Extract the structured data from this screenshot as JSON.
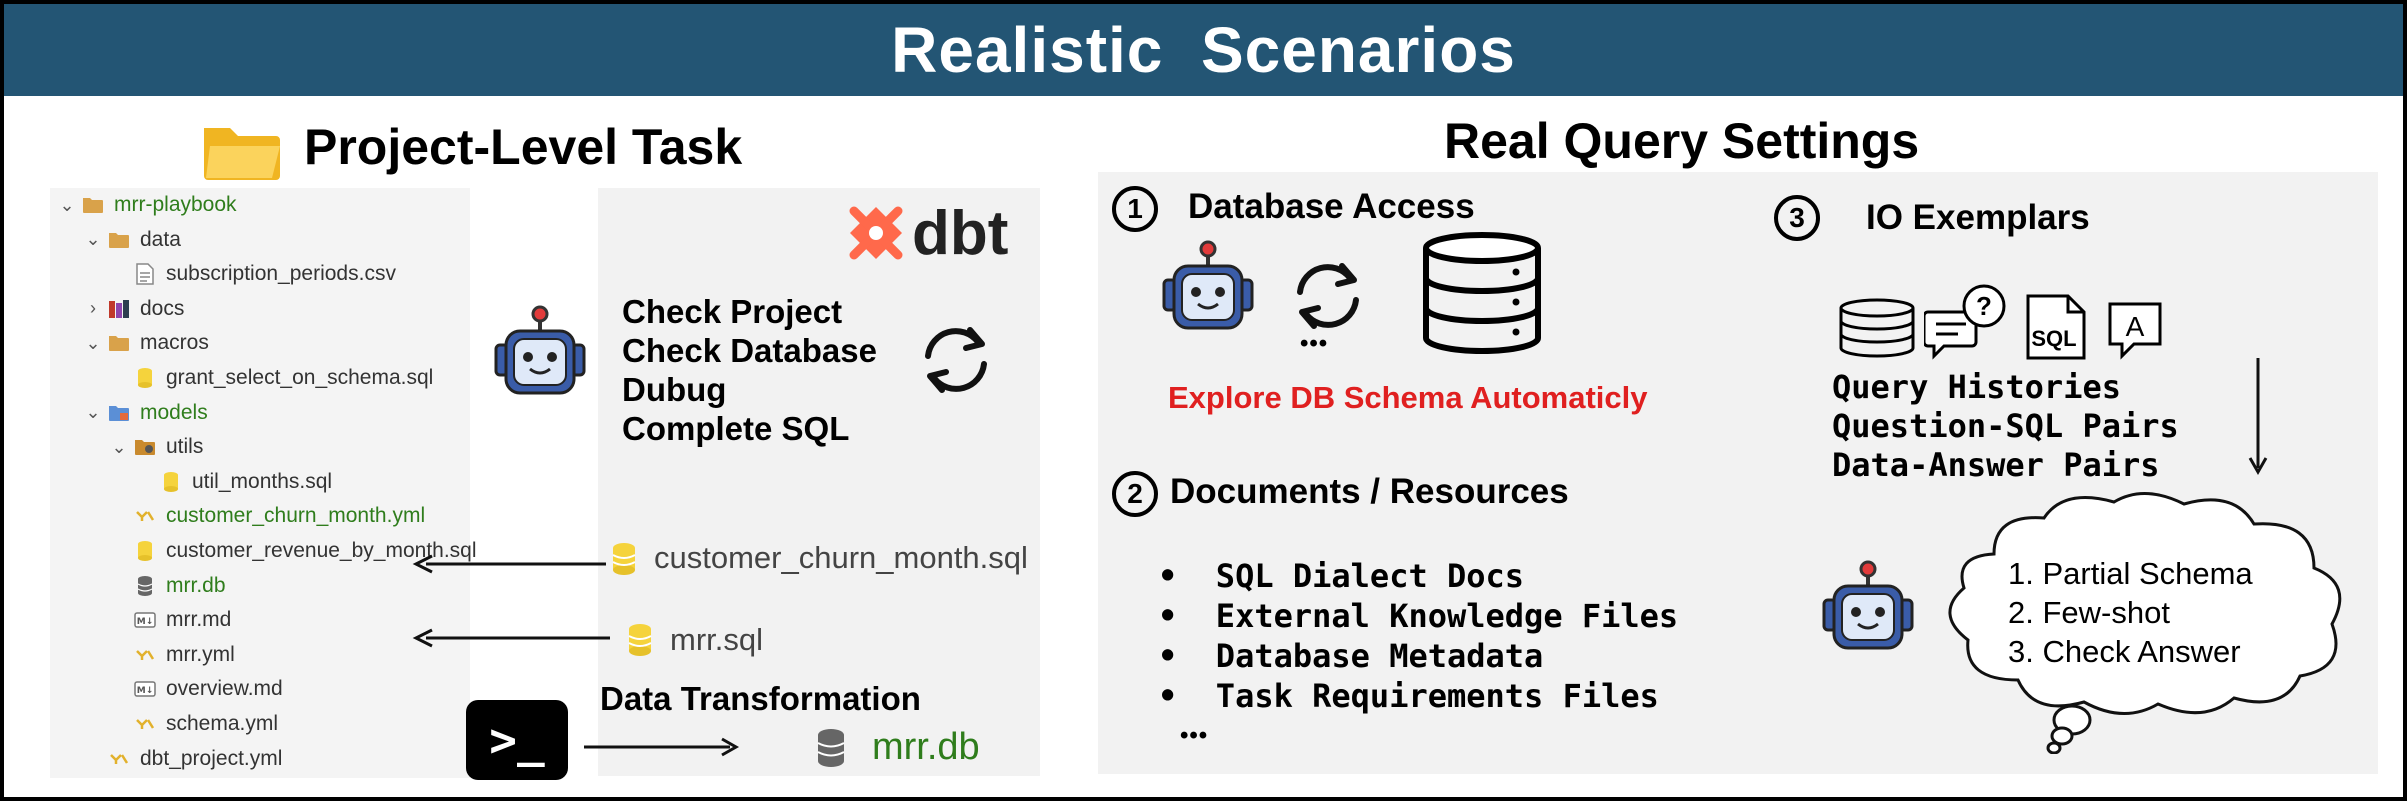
{
  "banner": {
    "title": "Realistic  Scenarios"
  },
  "left": {
    "title": "Project-Level Task",
    "tree": [
      {
        "label": "mrr-playbook",
        "depth": 0,
        "chevron": "down",
        "icon": "folder-icon",
        "green": true
      },
      {
        "label": "data",
        "depth": 1,
        "chevron": "down",
        "icon": "folder-icon",
        "green": false
      },
      {
        "label": "subscription_periods.csv",
        "depth": 2,
        "chevron": "",
        "icon": "file-icon",
        "green": false
      },
      {
        "label": "docs",
        "depth": 1,
        "chevron": "right",
        "icon": "books-icon",
        "green": false
      },
      {
        "label": "macros",
        "depth": 1,
        "chevron": "down",
        "icon": "folder-icon",
        "green": false
      },
      {
        "label": "grant_select_on_schema.sql",
        "depth": 2,
        "chevron": "",
        "icon": "sql-file-icon",
        "green": false
      },
      {
        "label": "models",
        "depth": 1,
        "chevron": "down",
        "icon": "models-folder-icon",
        "green": true
      },
      {
        "label": "utils",
        "depth": 2,
        "chevron": "down",
        "icon": "utils-folder-icon",
        "green": false
      },
      {
        "label": "util_months.sql",
        "depth": 3,
        "chevron": "",
        "icon": "sql-file-icon",
        "green": false
      },
      {
        "label": "customer_churn_month.yml",
        "depth": 2,
        "chevron": "",
        "icon": "yml-file-icon",
        "green": true
      },
      {
        "label": "customer_revenue_by_month.sql",
        "depth": 2,
        "chevron": "",
        "icon": "sql-file-icon",
        "green": false
      },
      {
        "label": "mrr.db",
        "depth": 2,
        "chevron": "",
        "icon": "database-icon",
        "green": true
      },
      {
        "label": "mrr.md",
        "depth": 2,
        "chevron": "",
        "icon": "markdown-file-icon",
        "green": false
      },
      {
        "label": "mrr.yml",
        "depth": 2,
        "chevron": "",
        "icon": "yml-file-icon",
        "green": false
      },
      {
        "label": "overview.md",
        "depth": 2,
        "chevron": "",
        "icon": "markdown-file-icon",
        "green": false
      },
      {
        "label": "schema.yml",
        "depth": 2,
        "chevron": "",
        "icon": "yml-file-icon",
        "green": false
      },
      {
        "label": "dbt_project.yml",
        "depth": 1,
        "chevron": "",
        "icon": "yml-file-icon",
        "green": false
      }
    ],
    "dbt_logo": "dbt",
    "agent_tasks": [
      "Check Project",
      "Check Database",
      "Dubug",
      "Complete SQL"
    ],
    "file_sql_1": "customer_churn_month.sql",
    "file_sql_2": "mrr.sql",
    "data_transformation": "Data Transformation",
    "output_db": "mrr.db",
    "terminal_glyph": ">_"
  },
  "right": {
    "title": "Real Query Settings",
    "db_access": {
      "num": "1",
      "title": "Database Access",
      "ellipsis": "•••",
      "caption": "Explore DB Schema Automaticly"
    },
    "documents": {
      "num": "2",
      "title": "Documents / Resources",
      "items": [
        "SQL Dialect Docs",
        "External Knowledge Files",
        "Database Metadata",
        "Task Requirements Files"
      ],
      "more": "•••"
    },
    "io": {
      "num": "3",
      "title": "IO Exemplars",
      "lines": [
        "Query Histories",
        "Question-SQL Pairs",
        "Data-Answer Pairs"
      ],
      "icon_sql": "SQL",
      "icon_a": "A",
      "icon_q": "?",
      "cloud": [
        "1. Partial Schema",
        "2. Few-shot",
        "3. Check Answer"
      ]
    }
  },
  "colors": {
    "banner": "#235574",
    "red": "#e02020",
    "green": "#2f7d1c",
    "dbt": "#ff694b",
    "robot": "#3a5ca8"
  }
}
